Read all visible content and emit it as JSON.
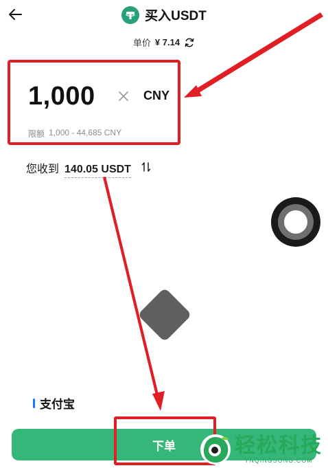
{
  "header": {
    "title": "买入USDT",
    "icons": {
      "back": "arrow-left-icon",
      "token": "tether-icon"
    }
  },
  "price": {
    "label": "单价",
    "value": "¥ 7.14",
    "icon": "refresh-icon"
  },
  "amount": {
    "value": "1,000",
    "currency": "CNY",
    "limit_label": "限额",
    "limit_value": "1,000 - 44,685 CNY",
    "clear_icon": "close-icon"
  },
  "receive": {
    "label": "您收到",
    "value": "140.05 USDT",
    "icon": "swap-icon"
  },
  "payment": {
    "method": "支付宝"
  },
  "actions": {
    "order_label": "下单"
  },
  "watermark": {
    "cn": "轻松科技",
    "en": "YNQINGSONG.COM"
  },
  "colors": {
    "accent": "#35b77a",
    "tether": "#26a17b",
    "annotation": "#e01e24",
    "indicator": "#1677ff"
  }
}
